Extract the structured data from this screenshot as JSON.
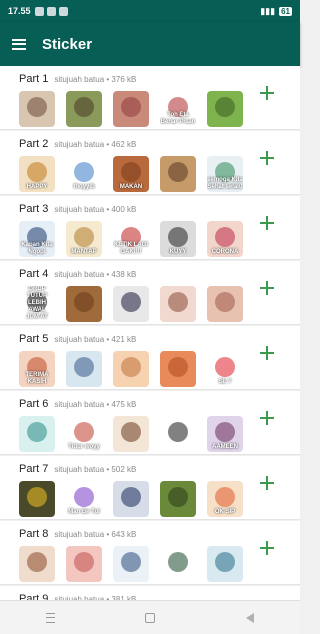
{
  "status": {
    "time": "17.55",
    "battery": "61"
  },
  "app": {
    "title": "Sticker"
  },
  "packs": [
    {
      "name": "Part 1",
      "meta": "situjuah batua • 376 kB",
      "stickers": [
        {
          "bg": "#d9c6b0",
          "fg": "#6b4a3a",
          "cap": ""
        },
        {
          "bg": "#8a9a5a",
          "fg": "#4b3a28",
          "cap": ""
        },
        {
          "bg": "#c98a7a",
          "fg": "#8e3b3b",
          "cap": ""
        },
        {
          "bg": "#ffffff",
          "fg": "#b02a2a",
          "cap": "Toh Eta Benar Pisan"
        },
        {
          "bg": "#7fb34d",
          "fg": "#3c5c22",
          "cap": ""
        }
      ]
    },
    {
      "name": "Part 2",
      "meta": "situjuah batua • 462 kB",
      "stickers": [
        {
          "bg": "#f3e0c2",
          "fg": "#c0781a",
          "cap": "HAPPY"
        },
        {
          "bg": "#ffffff",
          "fg": "#3a7ac8",
          "cap": "thoyyib"
        },
        {
          "bg": "#b86a3c",
          "fg": "#7a3a1a",
          "cap": "MAKAN"
        },
        {
          "bg": "#c79a6a",
          "fg": "#5a3a22",
          "cap": ""
        },
        {
          "bg": "#e8f0f4",
          "fg": "#2e8b57",
          "cap": "semoga Kita Sehat selalu"
        }
      ]
    },
    {
      "name": "Part 3",
      "meta": "situjuah batua • 400 kB",
      "stickers": [
        {
          "bg": "#e6eef6",
          "fg": "#1a3a6a",
          "cap": "Kapan Kita Ngopi"
        },
        {
          "bg": "#f5ead0",
          "fg": "#b07a2a",
          "cap": "MANTAP"
        },
        {
          "bg": "#ffffff",
          "fg": "#c02020",
          "cap": "KETIK LAGI GAK!!!!"
        },
        {
          "bg": "#dcdcdc",
          "fg": "#222222",
          "cap": "KUYY"
        },
        {
          "bg": "#f2d6cc",
          "fg": "#c02a4a",
          "cap": "CORONA"
        }
      ]
    },
    {
      "name": "Part 4",
      "meta": "situjuah batua • 438 kB",
      "stickers": [
        {
          "bg": "#ffffff",
          "fg": "#111111",
          "cap": "GRUP TUTUP LEBIH AWAL JUM'AT"
        },
        {
          "bg": "#a06a3a",
          "fg": "#6a3a1a",
          "cap": ""
        },
        {
          "bg": "#e8e8e8",
          "fg": "#1a1a3a",
          "cap": ""
        },
        {
          "bg": "#f1d9cf",
          "fg": "#8a4a3a",
          "cap": ""
        },
        {
          "bg": "#e7c2b0",
          "fg": "#a05a4a",
          "cap": ""
        }
      ]
    },
    {
      "name": "Part 5",
      "meta": "situjuah batua • 421 kB",
      "stickers": [
        {
          "bg": "#f4d4c0",
          "fg": "#c04a2a",
          "cap": "TERIMA KASIH"
        },
        {
          "bg": "#d8e6f0",
          "fg": "#3a5a8a",
          "cap": ""
        },
        {
          "bg": "#f6d2b0",
          "fg": "#c0703a",
          "cap": ""
        },
        {
          "bg": "#e88a5a",
          "fg": "#b04a20",
          "cap": ""
        },
        {
          "bg": "#ffffff",
          "fg": "#e02030",
          "cap": "SE 7"
        }
      ]
    },
    {
      "name": "Part 6",
      "meta": "situjuah batua • 475 kB",
      "stickers": [
        {
          "bg": "#d8f0ee",
          "fg": "#2a8a8a",
          "cap": ""
        },
        {
          "bg": "#ffffff",
          "fg": "#c03a2a",
          "cap": "Tidur woyy"
        },
        {
          "bg": "#f3e6d6",
          "fg": "#6a3a22",
          "cap": ""
        },
        {
          "bg": "#ffffff",
          "fg": "#1a1a1a",
          "cap": ""
        },
        {
          "bg": "#e0d4ea",
          "fg": "#6a2a5a",
          "cap": "AAMEEN"
        }
      ]
    },
    {
      "name": "Part 7",
      "meta": "situjuah batua • 502 kB",
      "stickers": [
        {
          "bg": "#4a4a2a",
          "fg": "#f0c020",
          "cap": ""
        },
        {
          "bg": "#ffffff",
          "fg": "#7a3ac8",
          "cap": "Man Be Tul"
        },
        {
          "bg": "#d6dde8",
          "fg": "#1a2a5a",
          "cap": ""
        },
        {
          "bg": "#6a8a3a",
          "fg": "#2a3a1a",
          "cap": ""
        },
        {
          "bg": "#f6e0c8",
          "fg": "#e05a2a",
          "cap": "OK SIP"
        }
      ]
    },
    {
      "name": "Part 8",
      "meta": "situjuah batua • 643 kB",
      "stickers": [
        {
          "bg": "#f0dccc",
          "fg": "#8a4a2a",
          "cap": ""
        },
        {
          "bg": "#f4c6c0",
          "fg": "#c0504a",
          "cap": ""
        },
        {
          "bg": "#eaf2f8",
          "fg": "#2a4a7a",
          "cap": ""
        },
        {
          "bg": "#ffffff",
          "fg": "#1a4a2a",
          "cap": ""
        },
        {
          "bg": "#d8eaf0",
          "fg": "#2a6a8a",
          "cap": ""
        }
      ]
    },
    {
      "name": "Part 9",
      "meta": "situjuah batua • 381 kB",
      "stickers": []
    }
  ]
}
